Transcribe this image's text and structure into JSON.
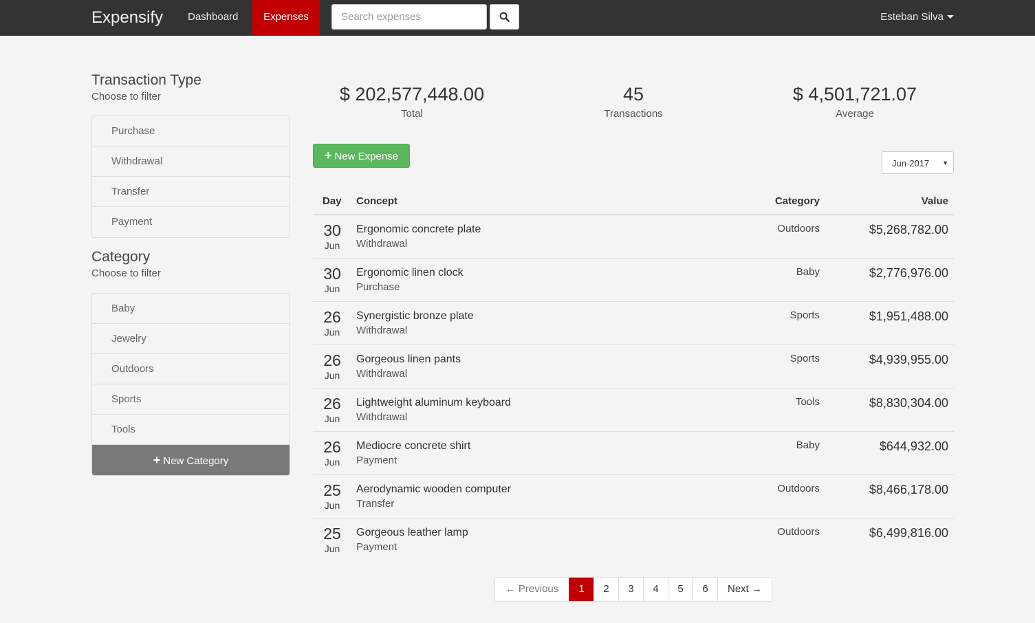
{
  "nav": {
    "brand": "Expensify",
    "links": [
      "Dashboard",
      "Expenses"
    ],
    "search_placeholder": "Search expenses",
    "user": "Esteban Silva"
  },
  "sidebar": {
    "transaction_type": {
      "title": "Transaction Type",
      "subtitle": "Choose to filter",
      "items": [
        "Purchase",
        "Withdrawal",
        "Transfer",
        "Payment"
      ]
    },
    "category": {
      "title": "Category",
      "subtitle": "Choose to filter",
      "items": [
        "Baby",
        "Jewelry",
        "Outdoors",
        "Sports",
        "Tools"
      ],
      "new_button": "New Category"
    }
  },
  "stats": {
    "total": {
      "value": "$ 202,577,448.00",
      "label": "Total"
    },
    "transactions": {
      "value": "45",
      "label": "Transactions"
    },
    "average": {
      "value": "$ 4,501,721.07",
      "label": "Average"
    }
  },
  "toolbar": {
    "new_expense": "New Expense",
    "month": "Jun-2017"
  },
  "table": {
    "headers": {
      "day": "Day",
      "concept": "Concept",
      "category": "Category",
      "value": "Value"
    },
    "rows": [
      {
        "day": "30",
        "month": "Jun",
        "concept": "Ergonomic concrete plate",
        "type": "Withdrawal",
        "category": "Outdoors",
        "value": "$5,268,782.00"
      },
      {
        "day": "30",
        "month": "Jun",
        "concept": "Ergonomic linen clock",
        "type": "Purchase",
        "category": "Baby",
        "value": "$2,776,976.00"
      },
      {
        "day": "26",
        "month": "Jun",
        "concept": "Synergistic bronze plate",
        "type": "Withdrawal",
        "category": "Sports",
        "value": "$1,951,488.00"
      },
      {
        "day": "26",
        "month": "Jun",
        "concept": "Gorgeous linen pants",
        "type": "Withdrawal",
        "category": "Sports",
        "value": "$4,939,955.00"
      },
      {
        "day": "26",
        "month": "Jun",
        "concept": "Lightweight aluminum keyboard",
        "type": "Withdrawal",
        "category": "Tools",
        "value": "$8,830,304.00"
      },
      {
        "day": "26",
        "month": "Jun",
        "concept": "Mediocre concrete shirt",
        "type": "Payment",
        "category": "Baby",
        "value": "$644,932.00"
      },
      {
        "day": "25",
        "month": "Jun",
        "concept": "Aerodynamic wooden computer",
        "type": "Transfer",
        "category": "Outdoors",
        "value": "$8,466,178.00"
      },
      {
        "day": "25",
        "month": "Jun",
        "concept": "Gorgeous leather lamp",
        "type": "Payment",
        "category": "Outdoors",
        "value": "$6,499,816.00"
      }
    ]
  },
  "pagination": {
    "previous": "← Previous",
    "pages": [
      "1",
      "2",
      "3",
      "4",
      "5",
      "6"
    ],
    "active": "1",
    "next": "Next →"
  },
  "colors": {
    "navbar": "#333333",
    "accent": "#c00000",
    "success": "#5cb85c",
    "category_button": "#7a7a7a"
  }
}
